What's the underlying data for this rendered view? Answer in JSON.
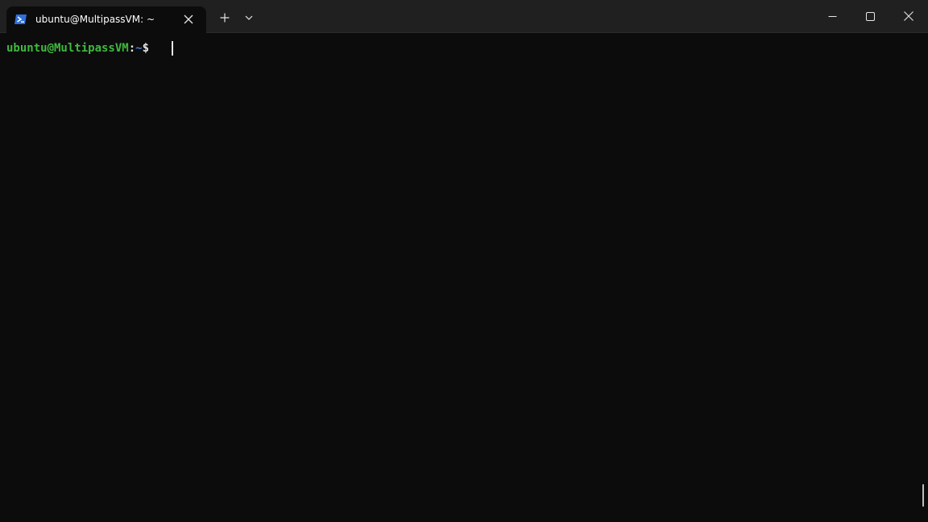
{
  "tab": {
    "title": "ubuntu@MultipassVM: ~",
    "icon": "powershell-icon",
    "close_icon": "close-icon"
  },
  "toolbar": {
    "new_tab_icon": "plus-icon",
    "dropdown_icon": "chevron-down-icon"
  },
  "window_controls": {
    "minimize_icon": "minimize-icon",
    "maximize_icon": "maximize-icon",
    "close_icon": "close-icon"
  },
  "terminal": {
    "prompt_user_host": "ubuntu@MultipassVM",
    "prompt_separator": ":",
    "prompt_path": "~",
    "prompt_symbol": "$ ",
    "input": ""
  },
  "colors": {
    "background": "#0c0c0c",
    "titlebar": "#202020",
    "prompt_user": "#3fb93f",
    "prompt_path": "#4a7dd1",
    "text": "#e6e6e6"
  }
}
